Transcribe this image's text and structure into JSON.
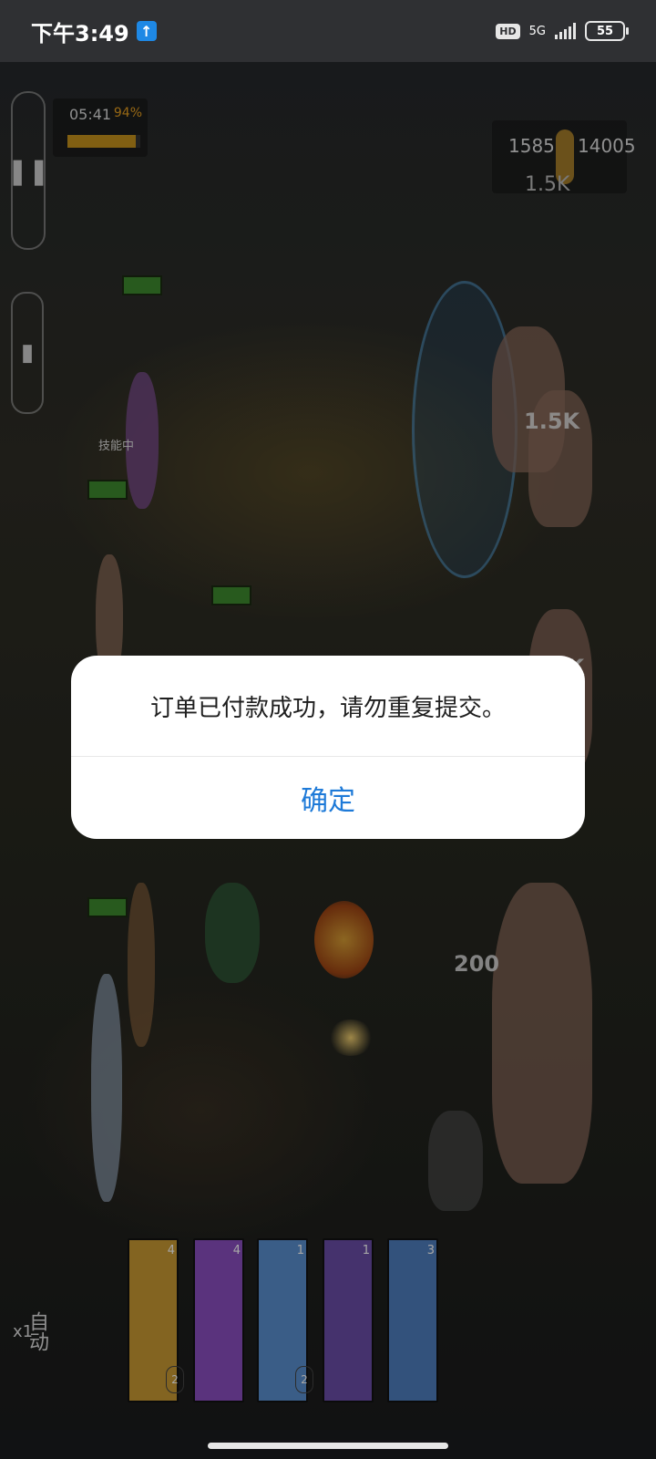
{
  "status_bar": {
    "time": "下午3:49",
    "hd": "HD",
    "network": "5G",
    "battery": "55"
  },
  "game": {
    "timer_text": "05:41",
    "timer_percent": "94%",
    "timer_progress": 0.94,
    "resource_a": "1585",
    "resource_b": "14005",
    "resource_sub": "1.5K",
    "status_label": "技能中",
    "damage_labels": [
      "1.5K",
      "1.5K",
      "200"
    ],
    "auto_label": "自动",
    "speed_label": "x1",
    "cards": [
      {
        "level": "4",
        "cost": "2",
        "color": "#c99a33"
      },
      {
        "level": "4",
        "cost": "",
        "color": "#8a4fc0"
      },
      {
        "level": "1",
        "cost": "2",
        "color": "#5a8fcf"
      },
      {
        "level": "1",
        "cost": "",
        "color": "#6a4da8"
      },
      {
        "level": "3",
        "cost": "",
        "color": "#4f7fbf"
      }
    ]
  },
  "dialog": {
    "message": "订单已付款成功，请勿重复提交。",
    "confirm_label": "确定"
  }
}
